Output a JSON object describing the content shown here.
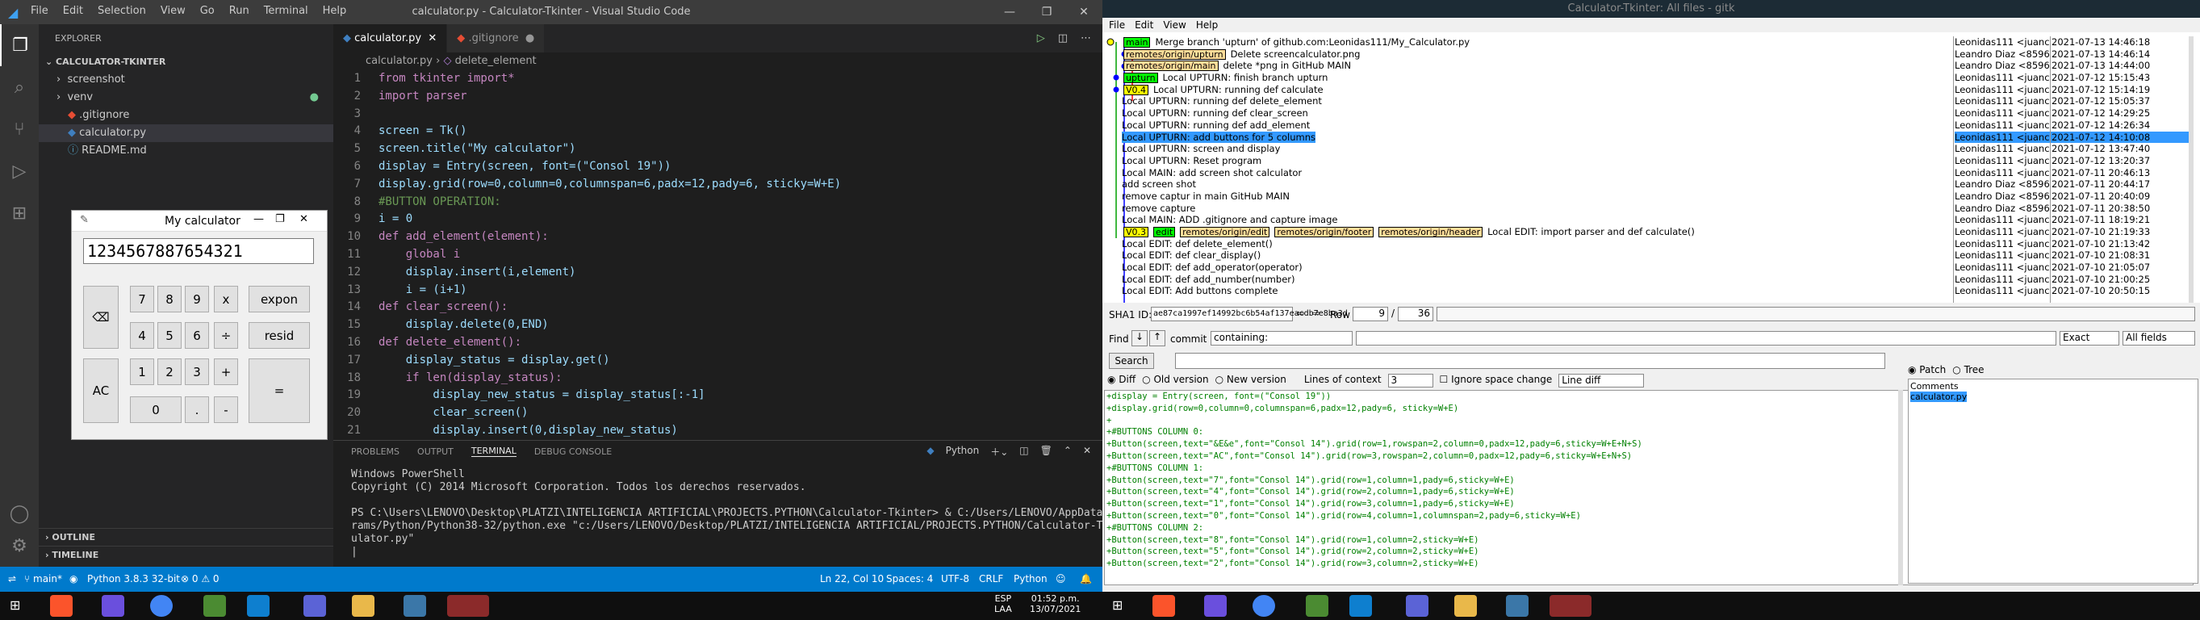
{
  "vscode": {
    "menu": [
      "File",
      "Edit",
      "Selection",
      "View",
      "Go",
      "Run",
      "Terminal",
      "Help"
    ],
    "title": "calculator.py - Calculator-Tkinter - Visual Studio Code",
    "explorer": "EXPLORER",
    "project": "CALCULATOR-TKINTER",
    "files": [
      "screenshot",
      "venv",
      ".gitignore",
      "calculator.py",
      "README.md"
    ],
    "outline": "OUTLINE",
    "timeline": "TIMELINE",
    "tabs": [
      "calculator.py",
      ".gitignore"
    ],
    "breadcrumb": [
      "calculator.py",
      "delete_element"
    ],
    "code": [
      [
        "from tkinter import*"
      ],
      [
        "import parser"
      ],
      [
        ""
      ],
      [
        "screen = Tk()"
      ],
      [
        "screen.title(\"My calculator\")"
      ],
      [
        "display = Entry(screen, font=(\"Consol 19\"))"
      ],
      [
        "display.grid(row=0,column=0,columnspan=6,padx=12,pady=6, sticky=W+E)"
      ],
      [
        "#BUTTON OPERATION:"
      ],
      [
        "i = 0"
      ],
      [
        "def add_element(element):"
      ],
      [
        "    global i"
      ],
      [
        "    display.insert(i,element)"
      ],
      [
        "    i = (i+1)"
      ],
      [
        "def clear_screen():"
      ],
      [
        "    display.delete(0,END)"
      ],
      [
        "def delete_element():"
      ],
      [
        "    display_status = display.get()"
      ],
      [
        "    if len(display_status):"
      ],
      [
        "        display_new_status = display_status[:-1]"
      ],
      [
        "        clear_screen()"
      ],
      [
        "        display.insert(0,display_new_status)"
      ]
    ],
    "panel_tabs": [
      "PROBLEMS",
      "OUTPUT",
      "TERMINAL",
      "DEBUG CONSOLE"
    ],
    "terminal_kind": "Python",
    "terminal": "Windows PowerShell\nCopyright (C) 2014 Microsoft Corporation. Todos los derechos reservados.\n\nPS C:\\Users\\LENOVO\\Desktop\\PLATZI\\INTELIGENCIA ARTIFICIAL\\PROJECTS.PYTHON\\Calculator-Tkinter> & C:/Users/LENOVO/AppData/Local/Prog\nrams/Python/Python38-32/python.exe \"c:/Users/LENOVO/Desktop/PLATZI/INTELIGENCIA ARTIFICIAL/PROJECTS.PYTHON/Calculator-Tkinter/calc\nulator.py\"\n|",
    "status": {
      "branch": "main*",
      "python": "Python 3.8.3 32-bit",
      "problems": "⊗ 0 ⚠ 0",
      "position": "Ln 22, Col 10",
      "spaces": "Spaces: 4",
      "enc": "UTF-8",
      "eol": "CRLF",
      "lang": "Python"
    }
  },
  "calculator": {
    "title": "My calculator",
    "display": "1234567887654321",
    "buttons": [
      "7",
      "8",
      "9",
      "x",
      "expon",
      "4",
      "5",
      "6",
      "÷",
      "resid",
      "1",
      "2",
      "3",
      "+",
      "0",
      ".",
      "-",
      "=",
      "AC",
      "⌫"
    ]
  },
  "gitk": {
    "title": "Calculator-Tkinter: All files - gitk",
    "menu": [
      "File",
      "Edit",
      "View",
      "Help"
    ],
    "commits": [
      {
        "refs": [
          "main"
        ],
        "msg": "Merge branch 'upturn' of github.com:Leonidas111/My_Calculator.py",
        "author": "Leonidas111 <juanc",
        "date": "2021-07-13 14:46:18"
      },
      {
        "refs": [
          "remotes/origin/upturn"
        ],
        "msg": "Delete screencalculator.png",
        "author": "Leandro Diaz <8596",
        "date": "2021-07-13 14:46:14"
      },
      {
        "refs": [
          "remotes/origin/main"
        ],
        "msg": "delete *png in GitHub MAIN",
        "author": "Leandro Diaz <8596",
        "date": "2021-07-13 14:44:00"
      },
      {
        "refs": [
          "upturn"
        ],
        "msg": "Local UPTURN: finish branch upturn",
        "author": "Leonidas111 <juanc",
        "date": "2021-07-12 15:15:43"
      },
      {
        "refs": [
          "V0.4"
        ],
        "msg": "Local UPTURN: running def calculate",
        "author": "Leonidas111 <juanc",
        "date": "2021-07-12 15:14:19"
      },
      {
        "refs": [],
        "msg": "Local UPTURN: running def delete_element",
        "author": "Leonidas111 <juanc",
        "date": "2021-07-12 15:05:37"
      },
      {
        "refs": [],
        "msg": "Local UPTURN: running def clear_screen",
        "author": "Leonidas111 <juanc",
        "date": "2021-07-12 14:29:25"
      },
      {
        "refs": [],
        "msg": "Local UPTURN: running def add_element",
        "author": "Leonidas111 <juanc",
        "date": "2021-07-12 14:26:34"
      },
      {
        "refs": [],
        "msg": "Local UPTURN: add buttons for 5 columns",
        "author": "Leonidas111 <juanc",
        "date": "2021-07-12 14:10:08",
        "selected": true
      },
      {
        "refs": [],
        "msg": "Local UPTURN: screen and display",
        "author": "Leonidas111 <juanc",
        "date": "2021-07-12 13:47:40"
      },
      {
        "refs": [],
        "msg": "Local UPTURN: Reset program",
        "author": "Leonidas111 <juanc",
        "date": "2021-07-12 13:20:37"
      },
      {
        "refs": [],
        "msg": "Local MAIN: add screen shot calculator",
        "author": "Leonidas111 <juanc",
        "date": "2021-07-11 20:46:13"
      },
      {
        "refs": [],
        "msg": "add screen shot",
        "author": "Leandro Diaz <8596",
        "date": "2021-07-11 20:44:17"
      },
      {
        "refs": [],
        "msg": "remove captur in main GitHub MAIN",
        "author": "Leandro Diaz <8596",
        "date": "2021-07-11 20:40:09"
      },
      {
        "refs": [],
        "msg": "remove capture",
        "author": "Leandro Diaz <8596",
        "date": "2021-07-11 20:38:50"
      },
      {
        "refs": [],
        "msg": "Local MAIN: ADD .gitignore and capture image",
        "author": "Leonidas111 <juanc",
        "date": "2021-07-11 18:19:21"
      },
      {
        "refs": [
          "V0.3",
          "edit",
          "remotes/origin/edit",
          "remotes/origin/footer",
          "remotes/origin/header"
        ],
        "msg": "Local EDIT: import parser and def calculate()",
        "author": "Leonidas111 <juanc",
        "date": "2021-07-10 21:19:33"
      },
      {
        "refs": [],
        "msg": "Local EDIT: def delete_element()",
        "author": "Leonidas111 <juanc",
        "date": "2021-07-10 21:13:42"
      },
      {
        "refs": [],
        "msg": "Local EDIT: def clear_display()",
        "author": "Leonidas111 <juanc",
        "date": "2021-07-10 21:08:31"
      },
      {
        "refs": [],
        "msg": "Local EDIT: def add_operator(operator)",
        "author": "Leonidas111 <juanc",
        "date": "2021-07-10 21:05:07"
      },
      {
        "refs": [],
        "msg": "Local EDIT: def add_number(number)",
        "author": "Leonidas111 <juanc",
        "date": "2021-07-10 21:00:25"
      },
      {
        "refs": [],
        "msg": "Local EDIT: Add buttons complete",
        "author": "Leonidas111 <juanc",
        "date": "2021-07-10 20:50:15"
      }
    ],
    "sha_label": "SHA1 ID:",
    "sha": "ae87ca1997ef14992bc6b54af137eacdb7e8ba3d",
    "row_label": "Row",
    "row": "9",
    "row_total": "36",
    "find_label": "Find",
    "commit_label": "commit",
    "find_mode": "containing:",
    "exact": "Exact",
    "fields": "All fields",
    "search": "Search",
    "diff_opts": [
      "Diff",
      "Old version",
      "New version"
    ],
    "context_label": "Lines of context",
    "context": "3",
    "ignore_ws": "Ignore space change",
    "line_diff": "Line diff",
    "patch": "Patch",
    "tree": "Tree",
    "comments": "Comments",
    "file": "calculator.py",
    "diff": "+display = Entry(screen, font=(\"Consol 19\"))\n+display.grid(row=0,column=0,columnspan=6,padx=12,pady=6, sticky=W+E)\n+\n+#BUTTONS COLUMN 0:\n+Button(screen,text=\"&E&e\",font=\"Consol 14\").grid(row=1,rowspan=2,column=0,padx=12,pady=6,sticky=W+E+N+S)\n+Button(screen,text=\"AC\",font=\"Consol 14\").grid(row=3,rowspan=2,column=0,padx=12,pady=6,sticky=W+E+N+S)\n+#BUTTONS COLUMN 1:\n+Button(screen,text=\"7\",font=\"Consol 14\").grid(row=1,column=1,pady=6,sticky=W+E)\n+Button(screen,text=\"4\",font=\"Consol 14\").grid(row=2,column=1,pady=6,sticky=W+E)\n+Button(screen,text=\"1\",font=\"Consol 14\").grid(row=3,column=1,pady=6,sticky=W+E)\n+Button(screen,text=\"0\",font=\"Consol 14\").grid(row=4,column=1,columnspan=2,pady=6,sticky=W+E)\n+#BUTTONS COLUMN 2:\n+Button(screen,text=\"8\",font=\"Consol 14\").grid(row=1,column=2,sticky=W+E)\n+Button(screen,text=\"5\",font=\"Consol 14\").grid(row=2,column=2,sticky=W+E)\n+Button(screen,text=\"2\",font=\"Consol 14\").grid(row=3,column=2,sticky=W+E)"
  },
  "taskbar": {
    "lang": "ESP",
    "kbd": "LAA",
    "time": "01:52 p.m.",
    "date": "13/07/2021"
  }
}
